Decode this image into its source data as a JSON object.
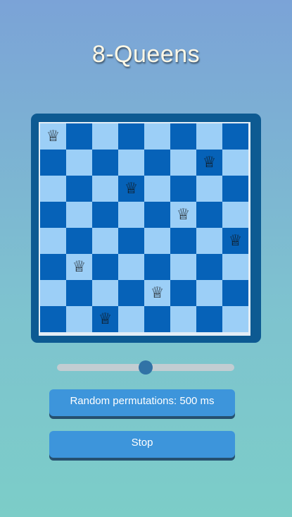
{
  "title": "8-Queens",
  "board": {
    "size": 8,
    "queen_glyph": "♕",
    "queen_columns_by_row": [
      0,
      6,
      3,
      5,
      7,
      1,
      4,
      2
    ],
    "colors": {
      "light": "#9ccff7",
      "dark": "#0662b8",
      "frame": "#0d5a92"
    }
  },
  "slider": {
    "value_fraction": 0.5
  },
  "buttons": {
    "random_label": "Random permutations: 500 ms",
    "stop_label": "Stop"
  },
  "colors": {
    "button": "#3d95db",
    "button_shadow": "#25506f",
    "title": "#fff8e6"
  }
}
